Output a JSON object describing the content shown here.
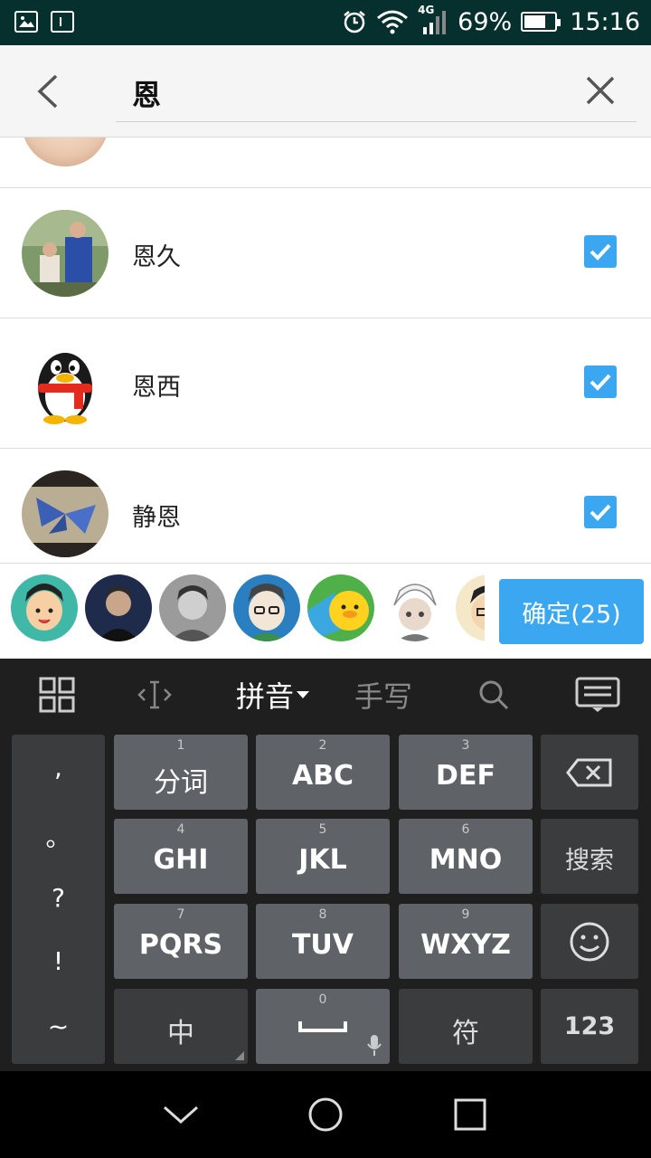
{
  "status_bar": {
    "network_label": "4G",
    "battery_percent": "69%",
    "battery_level": 0.69,
    "time": "15:16"
  },
  "search": {
    "query": "恩"
  },
  "contacts": [
    {
      "name": "",
      "checked": true,
      "avatar": "partial-avatar"
    },
    {
      "name": "恩久",
      "checked": true,
      "avatar": "photo-two-boys"
    },
    {
      "name": "恩西",
      "checked": true,
      "avatar": "qq-penguin"
    },
    {
      "name": "静恩",
      "checked": true,
      "avatar": "butterfly"
    }
  ],
  "selected_avatars": [
    "cartoon-boy",
    "photo-young-man",
    "photo-grayscale",
    "cartoon-glasses",
    "sticker-duck",
    "anime-white-hair",
    "cartoon-partial"
  ],
  "confirm_button": {
    "label": "确定(25)"
  },
  "keyboard": {
    "toolbar": {
      "pinyin_label": "拼音",
      "handwrite_label": "手写"
    },
    "punctuation": [
      ",",
      "。",
      "?",
      "!",
      "~"
    ],
    "keys": {
      "k1": {
        "num": "1",
        "label": "分词"
      },
      "k2": {
        "num": "2",
        "label": "ABC"
      },
      "k3": {
        "num": "3",
        "label": "DEF"
      },
      "k4": {
        "num": "4",
        "label": "GHI"
      },
      "k5": {
        "num": "5",
        "label": "JKL"
      },
      "k6": {
        "num": "6",
        "label": "MNO"
      },
      "k7": {
        "num": "7",
        "label": "PQRS"
      },
      "k8": {
        "num": "8",
        "label": "TUV"
      },
      "k9": {
        "num": "9",
        "label": "WXYZ"
      },
      "k0": {
        "num": "0",
        "label": ""
      },
      "search": {
        "label": "搜索"
      },
      "zhong": {
        "label": "中"
      },
      "fu": {
        "label": "符"
      },
      "num": {
        "label": "123"
      }
    }
  }
}
